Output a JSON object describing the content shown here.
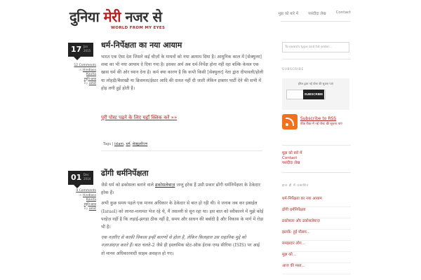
{
  "logo": {
    "part1": "दुनिया ",
    "part2": "मेरी",
    "part3": " नजर से",
    "tagline": "WORLD FROM MY EYES"
  },
  "nav": [
    "मुझ को बारे में",
    "पसंदीदा लेख",
    "Contact"
  ],
  "posts": [
    {
      "day": "17",
      "month": "Jan",
      "year": "2015",
      "title": "धर्म-निर्पेक्षता का नया आयाम",
      "meta": {
        "comments": "12 Comments",
        "category": "Hindlass Kavita",
        "extra": "स्मृति-कथा",
        "by": "By",
        "author": "amit"
      },
      "paragraphs": [
        "भारत  एक ऐसा देश जिसने कई चीज़ों के मायनों को नया आयाम दिया है। आधुनिक काल में [सेक्युलर] शब्द का भी नया आयाम दे दिया गया है। इसका अर्थ अब धर्म-निर्पेक्ष होना नहीं रहा बल्कि केवल एक खास धर्म की ओर ध्यान देना है। कर्म क्या कारण है कि कभी किसी [सेक्युलर] नेता द्वारा दीपावली/होली या लोहड़ी/बैसाखी या क्रिसमस/ईस्टर आदि की दावत नहीं दी जाती लेकिन इफ़्तार पार्टी देने की सभी में होड़ लगी हुई होती है।"
      ],
      "more": "पूरी पोस्ट पढ़ने के लिए यहाँ क्लिक करें »»",
      "tags_label": "Tags |",
      "tags": [
        "islam",
        "धर्म",
        "सेक्युलरिज्म"
      ]
    },
    {
      "day": "01",
      "month": "Dec",
      "year": "2014",
      "title": "ढोंगी धर्मनिर्पेक्षता",
      "meta": {
        "comments": "0 Comments",
        "category": "Hindlass Kavita",
        "extra": "स्मृति-कथा",
        "by": "By",
        "author": "amit"
      },
      "p1_before": "जैसे धर्म को ढकोसला बताने वाले ",
      "p1_link": "ढकोसलेबाज़",
      "p1_after": " जन्तु हरेक हैं उसी प्रकार ढोंगी धर्मनिर्पेक्षता के ठेकेदार हरेक हैं।",
      "p2": "अभी कुछ समय पहले एक मानव अधिकार के ठेकेदार से बात हो रही थी। वे जनाब जब कर इस्राईल (Israel) को लानत-मलामत भेज रहे थे, मैं तसल्ली से सुन रहा था। इस बात को स्वीकारने में मुझे कोई परहेज़ नहीं है कि लड़ाई-झगड़ा ठीक नहीं है, समय और साधन की बर्बादी है और विकास के मार्ग में रोड़ा भी है।",
      "p3_it": "एक नज़रिए से काफ़ी विकास इन्हीं कारणों से होता है, लेकिन फ़िलहाल उस राहानिक मुद्दे को नज़रअंदाज़ करते हैं।",
      "p3_rest": " बात चलते-2 जैसे ही इस्लामिक स्टेट-ऑफ़ ईराक एण्ड सीरिया (ISIS) पर आई तो मानव अधिकारवादी साहब असहज हो गए।"
    }
  ],
  "sidebar": {
    "search_placeholder": "To search type and hit enter...",
    "subscribe_head": "SUBSCRIBE",
    "subscribe_note": "ईमेल द्वारा नई पोस्ट की सूचना पाएं",
    "subscribe_btn": "SUBSCRIBE",
    "rss_title": "Subscribe to RSS",
    "rss_note": "फ़ीड रीडर में नई पोस्ट की सूचना पाएं",
    "pages": [
      "मुझ को बारे में",
      "Contact",
      "पसंदीदा लेख"
    ],
    "recent_head": "हाल ही में प्रकाशित",
    "recent": [
      "धर्म-निर्पेक्षता का नया आयाम",
      "ढोंगी धर्मनिर्पेक्षता",
      "ढकोसला और ढकोसलेबाज़",
      "झलकें: हुई मौसम...",
      "समझदार लोग...",
      "मुझ को...",
      "आज की मस्त..."
    ]
  }
}
